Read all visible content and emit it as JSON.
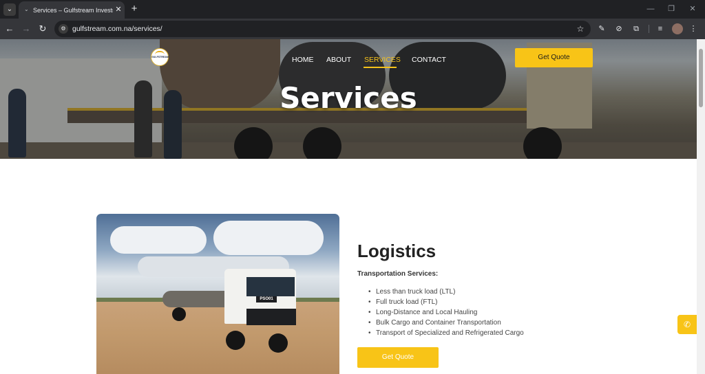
{
  "browser": {
    "tab_title": "Services – Gulfstream Investments",
    "tab_favicon": "⌄",
    "url": "gulfstream.com.na/services/"
  },
  "nav": {
    "items": [
      {
        "label": "HOME",
        "active": false
      },
      {
        "label": "ABOUT",
        "active": false
      },
      {
        "label": "SERVICES",
        "active": true
      },
      {
        "label": "CONTACT",
        "active": false
      }
    ],
    "cta_label": "Get Quote"
  },
  "hero": {
    "title": "Services",
    "logo_text": "GULFSTREAM"
  },
  "logistics": {
    "heading": "Logistics",
    "subheading": "Transportation Services:",
    "items": [
      "Less than truck load (LTL)",
      "Full truck load (FTL)",
      "Long-Distance and Local Hauling",
      "Bulk Cargo and Container Transportation",
      "Transport of Specialized and Refrigerated Cargo"
    ],
    "cta_label": "Get Quote",
    "photo_plate": "PSO01"
  },
  "colors": {
    "accent": "#f8c417",
    "nav_active": "#f6c21b",
    "chrome_dark": "#202124",
    "chrome_toolbar": "#35363a"
  },
  "icons": {
    "call": "phone-icon",
    "bookmark": "star-icon"
  }
}
